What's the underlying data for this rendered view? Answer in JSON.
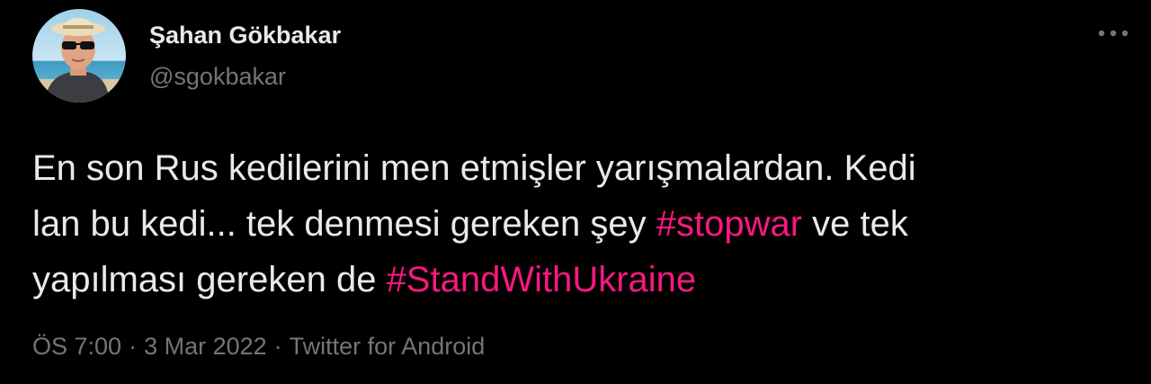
{
  "author": {
    "display_name": "Şahan Gökbakar",
    "handle": "@sgokbakar"
  },
  "tweet": {
    "line1": "En son Rus kedilerini men etmişler yarışmalardan. Kedi",
    "line2_part1": "lan bu kedi... tek denmesi gereken şey ",
    "hashtag_stopwar": "#stopwar",
    "line2_part2": " ve tek",
    "line3_part1": "yapılması gereken de ",
    "hashtag_standwithukraine": "#StandWithUkraine"
  },
  "meta": {
    "time": "ÖS 7:00",
    "separator": "·",
    "date": "3 Mar 2022",
    "source": "Twitter for Android"
  },
  "colors": {
    "background": "#000000",
    "text": "#e7e9ea",
    "secondary": "#71767b",
    "hashtag": "#f91880"
  },
  "icons": {
    "more": "more-horizontal-icon",
    "avatar": "profile-photo"
  }
}
